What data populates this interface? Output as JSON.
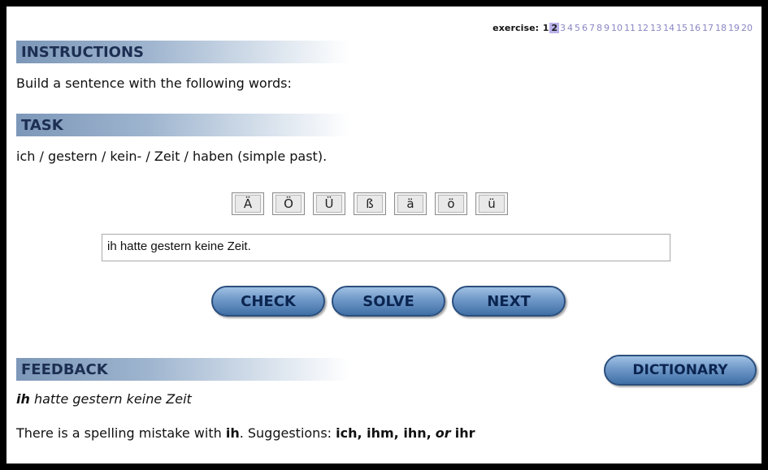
{
  "exercise_nav": {
    "label": "exercise:",
    "numbers": [
      "1",
      "2",
      "3",
      "4",
      "5",
      "6",
      "7",
      "8",
      "9",
      "10",
      "11",
      "12",
      "13",
      "14",
      "15",
      "16",
      "17",
      "18",
      "19",
      "20"
    ],
    "current": "2"
  },
  "instructions": {
    "heading": "INSTRUCTIONS",
    "text": "Build a sentence with the following words:"
  },
  "task": {
    "heading": "TASK",
    "text": "ich / gestern / kein- / Zeit / haben (simple past)."
  },
  "special_chars": [
    "Ä",
    "Ö",
    "Ü",
    "ß",
    "ä",
    "ö",
    "ü"
  ],
  "answer": {
    "value": "ih hatte gestern keine Zeit."
  },
  "buttons": {
    "check": "CHECK",
    "solve": "SOLVE",
    "next": "NEXT",
    "dictionary": "DICTIONARY"
  },
  "feedback": {
    "heading": "FEEDBACK",
    "error_word": "ih",
    "sentence_rest": " hatte gestern keine Zeit",
    "message_prefix": "There is a spelling mistake with ",
    "message_word": "ih",
    "message_mid": ". Suggestions: ",
    "suggestions": "ich, ihm, ihn,",
    "or_word": "or",
    "last_suggestion": "ihr"
  },
  "colors": {
    "header_gradient_start": "#7c97b8",
    "button_blue": "#6f98c8",
    "current_exercise": "#b9b1ea",
    "unvisited_exercise": "#8a86c4"
  }
}
